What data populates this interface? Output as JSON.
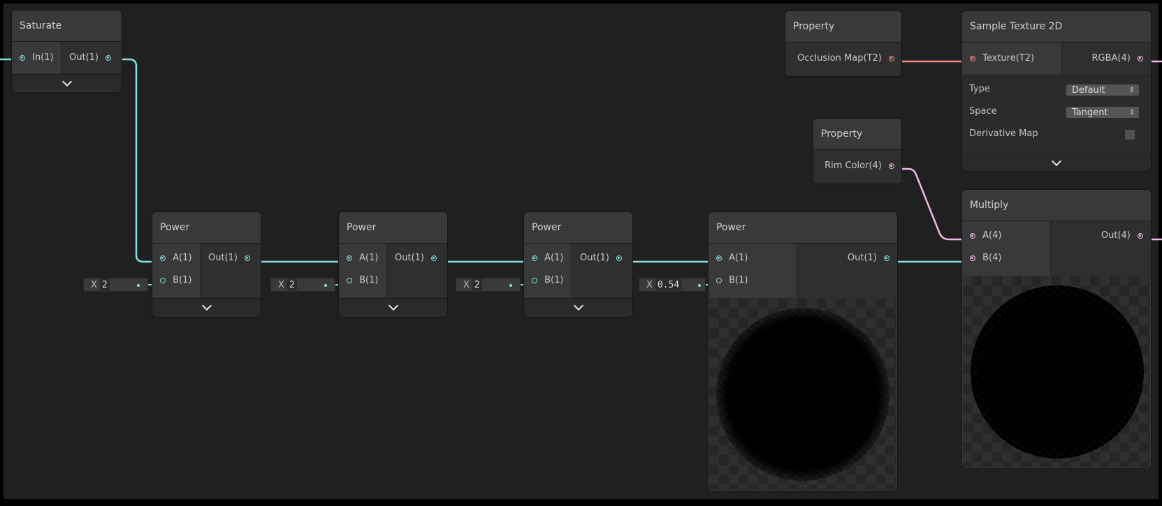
{
  "nodes": {
    "saturate": {
      "title": "Saturate",
      "in": "In(1)",
      "out": "Out(1)"
    },
    "power1": {
      "title": "Power",
      "a": "A(1)",
      "b": "B(1)",
      "out": "Out(1)",
      "x_label": "X",
      "x_value": "2"
    },
    "power2": {
      "title": "Power",
      "a": "A(1)",
      "b": "B(1)",
      "out": "Out(1)",
      "x_label": "X",
      "x_value": "2"
    },
    "power3": {
      "title": "Power",
      "a": "A(1)",
      "b": "B(1)",
      "out": "Out(1)",
      "x_label": "X",
      "x_value": "2"
    },
    "power4": {
      "title": "Power",
      "a": "A(1)",
      "b": "B(1)",
      "out": "Out(1)",
      "x_label": "X",
      "x_value": "0.54"
    },
    "property_occlusion": {
      "title": "Property",
      "out": "Occlusion Map(T2)"
    },
    "property_rim": {
      "title": "Property",
      "out": "Rim Color(4)"
    },
    "sample_texture": {
      "title": "Sample Texture 2D",
      "in": "Texture(T2)",
      "out": "RGBA(4)",
      "type_label": "Type",
      "type_value": "Default",
      "space_label": "Space",
      "space_value": "Tangent",
      "derivative_label": "Derivative Map"
    },
    "multiply": {
      "title": "Multiply",
      "a": "A(4)",
      "b": "B(4)",
      "out": "Out(4)"
    }
  },
  "colors": {
    "background": "#202020",
    "node_body": "#2b2b2b",
    "node_header": "#393939",
    "wire_vector1": "#86e0e0",
    "wire_vector4": "#f3b8e4",
    "wire_texture": "#f08a8a"
  },
  "icons": {
    "collapse": "chevron-down-icon",
    "dropdown_arrow": "updown-arrow-icon"
  }
}
